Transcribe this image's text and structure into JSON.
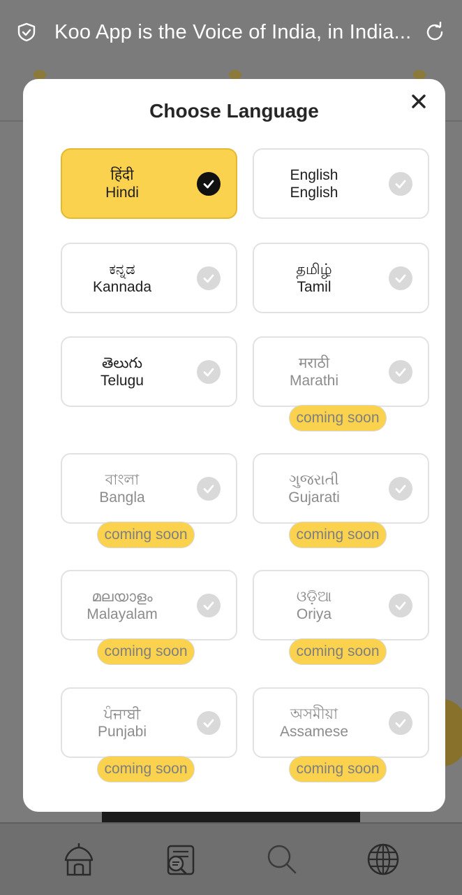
{
  "statusbar": {
    "title": "Koo App is the Voice of India, in India..."
  },
  "modal": {
    "title": "Choose Language",
    "languages": [
      {
        "native": "हिंदी",
        "english": "Hindi",
        "selected": true,
        "coming_soon": ""
      },
      {
        "native": "English",
        "english": "English",
        "selected": false,
        "coming_soon": ""
      },
      {
        "native": "ಕನ್ನಡ",
        "english": "Kannada",
        "selected": false,
        "coming_soon": ""
      },
      {
        "native": "தமிழ்",
        "english": "Tamil",
        "selected": false,
        "coming_soon": ""
      },
      {
        "native": "తెలుగు",
        "english": "Telugu",
        "selected": false,
        "coming_soon": ""
      },
      {
        "native": "मराठी",
        "english": "Marathi",
        "selected": false,
        "coming_soon": "coming soon"
      },
      {
        "native": "বাংলা",
        "english": "Bangla",
        "selected": false,
        "coming_soon": "coming soon"
      },
      {
        "native": "ગુજરાતી",
        "english": "Gujarati",
        "selected": false,
        "coming_soon": "coming soon"
      },
      {
        "native": "മലയാളം",
        "english": "Malayalam",
        "selected": false,
        "coming_soon": "coming soon"
      },
      {
        "native": "ଓଡ଼ିଆ",
        "english": "Oriya",
        "selected": false,
        "coming_soon": "coming soon"
      },
      {
        "native": "ਪੰਜਾਬੀ",
        "english": "Punjabi",
        "selected": false,
        "coming_soon": "coming soon"
      },
      {
        "native": "অসমীয়া",
        "english": "Assamese",
        "selected": false,
        "coming_soon": "coming soon"
      }
    ]
  },
  "bottom_nav": {
    "items": [
      {
        "icon": "home-icon"
      },
      {
        "icon": "explore-icon"
      },
      {
        "icon": "search-icon"
      },
      {
        "icon": "globe-icon"
      }
    ]
  },
  "colors": {
    "accent": "#fbd24d",
    "overlay": "#7b7b7b",
    "check_inactive": "#d9d9d9",
    "check_active": "#111111"
  }
}
